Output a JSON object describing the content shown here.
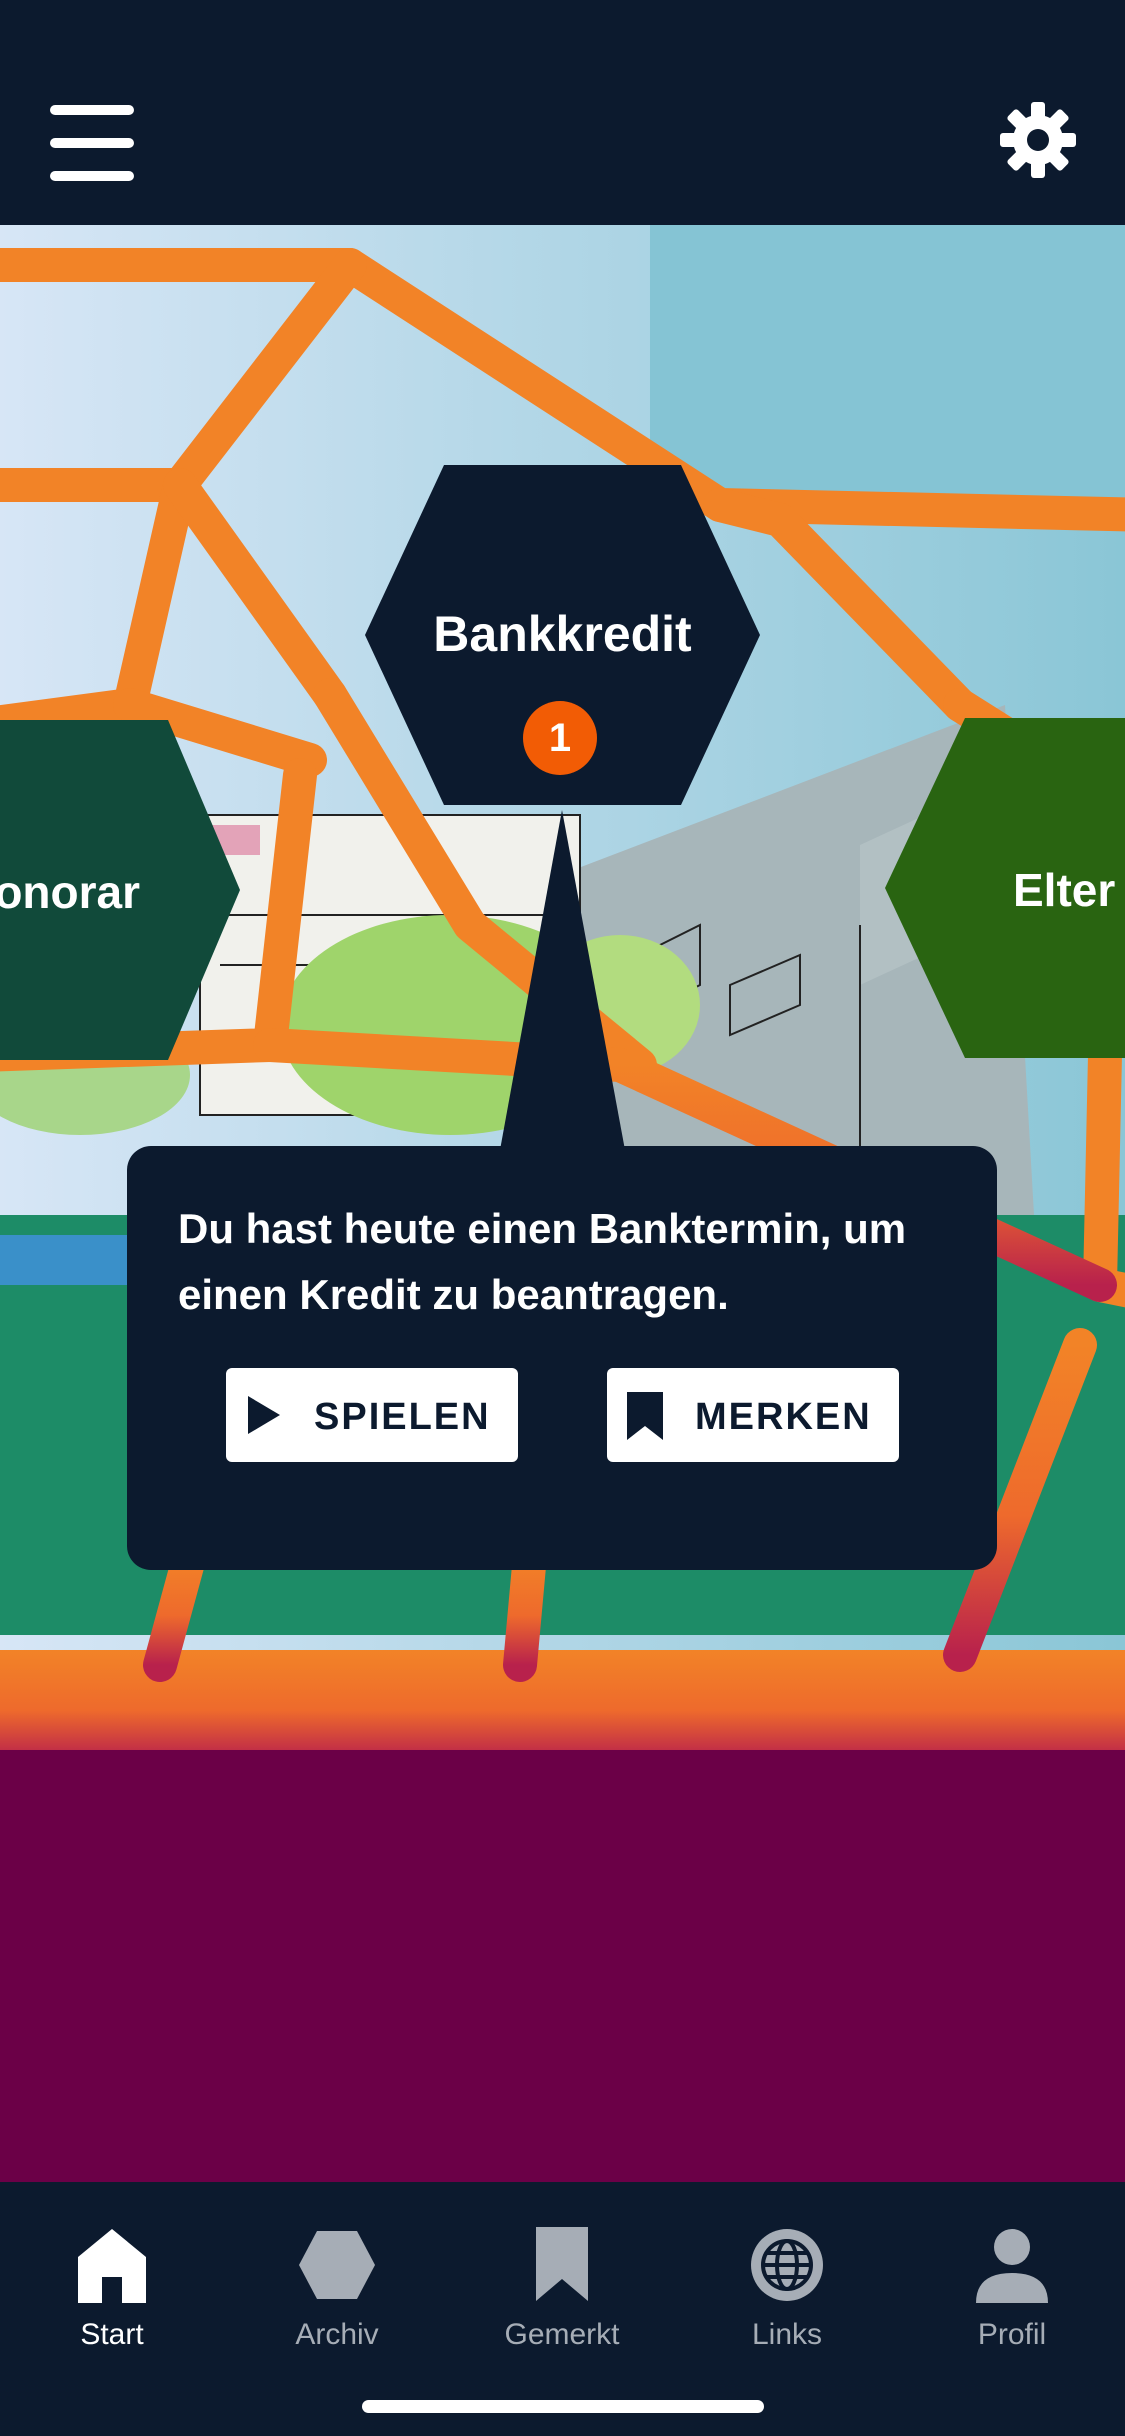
{
  "header": {
    "menu_icon": "hamburger-icon",
    "settings_icon": "gear-icon"
  },
  "scene": {
    "main_topic": {
      "title": "Bankkredit",
      "badge_count": "1"
    },
    "left_topic": {
      "title": "onorar"
    },
    "right_topic": {
      "title": "Elter"
    }
  },
  "popup": {
    "text": "Du hast heute einen Banktermin, um einen Kredit zu beantragen.",
    "play_label": "SPIELEN",
    "save_label": "MERKEN"
  },
  "tabs": [
    {
      "label": "Start",
      "icon": "home-icon",
      "active": true
    },
    {
      "label": "Archiv",
      "icon": "hexagon-icon",
      "active": false
    },
    {
      "label": "Gemerkt",
      "icon": "bookmark-icon",
      "active": false
    },
    {
      "label": "Links",
      "icon": "globe-icon",
      "active": false
    },
    {
      "label": "Profil",
      "icon": "user-icon",
      "active": false
    }
  ],
  "colors": {
    "navy": "#0c1a2e",
    "orange": "#f28327",
    "badge": "#f25c05",
    "sky": "#85c4d4",
    "grass": "#1a8a66",
    "plum": "#6b0047",
    "left_hex": "#114a3a",
    "right_hex": "#296411"
  }
}
